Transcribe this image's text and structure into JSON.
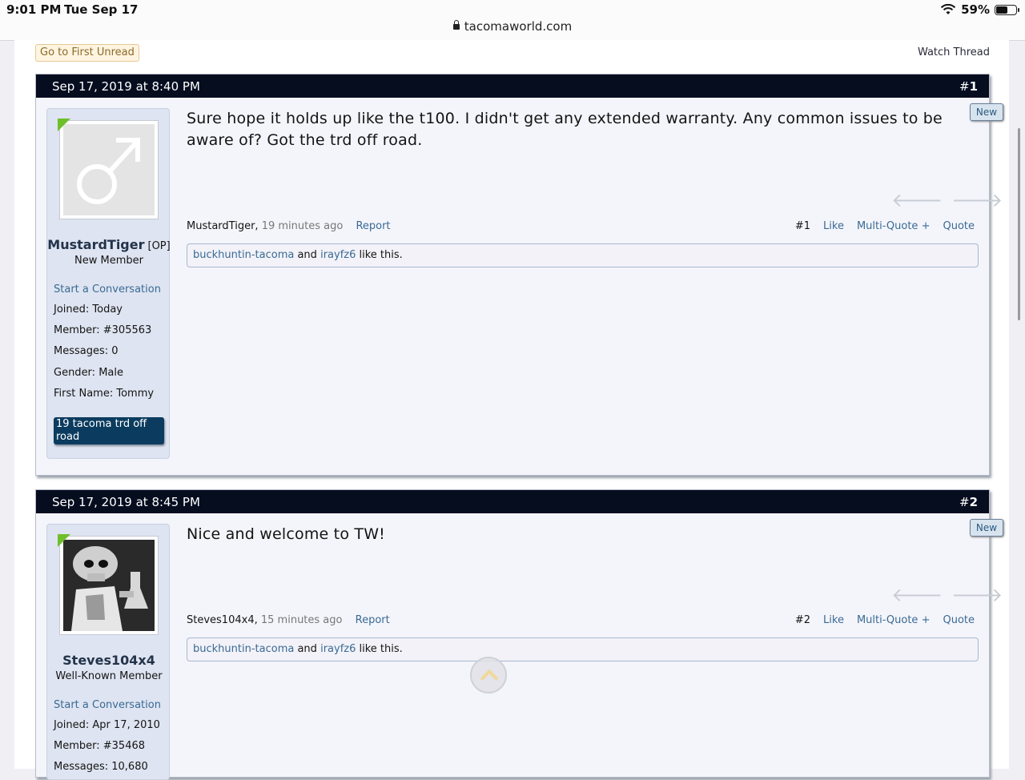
{
  "statusbar": {
    "time": "9:01 PM",
    "date": "Tue Sep 17",
    "battery": "59%",
    "url": "tacomaworld.com"
  },
  "thread": {
    "first_unread": "Go to First Unread",
    "watch": "Watch Thread"
  },
  "posts": [
    {
      "date": "Sep 17, 2019 at 8:40 PM",
      "num_prefix": "#",
      "num": "1",
      "new_label": "New",
      "username": "MustardTiger",
      "op_tag": "[OP]",
      "user_title": "New Member",
      "start_conv": "Start a Conversation",
      "joined": "Joined:  Today",
      "member": "Member:  #305563",
      "messages": "Messages:  0",
      "gender": "Gender:  Male",
      "first_name": "First Name: Tommy",
      "badge": "19 tacoma trd off road",
      "message_lines": [
        "Sure hope it holds up like the t100. I didn't get any extended warranty. Any common issues to be",
        "aware of? Got the trd off road."
      ],
      "meta_user": "MustardTiger,",
      "meta_ago": "19 minutes ago",
      "report": "Report",
      "post_link": "#1",
      "like": "Like",
      "multiquote": "Multi-Quote +",
      "quote": "Quote",
      "liker1": "buckhuntin-tacoma",
      "and": "and",
      "liker2": "irayfz6",
      "like_suffix": "like this."
    },
    {
      "date": "Sep 17, 2019 at 8:45 PM",
      "num_prefix": "#",
      "num": "2",
      "new_label": "New",
      "username": "Steves104x4",
      "user_title": "Well-Known Member",
      "start_conv": "Start a Conversation",
      "joined": "Joined:  Apr 17, 2010",
      "member": "Member:  #35468",
      "messages": "Messages:  10,680",
      "message_lines": [
        "Nice and welcome to TW!"
      ],
      "meta_user": "Steves104x4,",
      "meta_ago": "15 minutes ago",
      "report": "Report",
      "post_link": "#2",
      "like": "Like",
      "multiquote": "Multi-Quote +",
      "quote": "Quote",
      "liker1": "buckhuntin-tacoma",
      "and": "and",
      "liker2": "irayfz6",
      "like_suffix": "like this."
    }
  ]
}
